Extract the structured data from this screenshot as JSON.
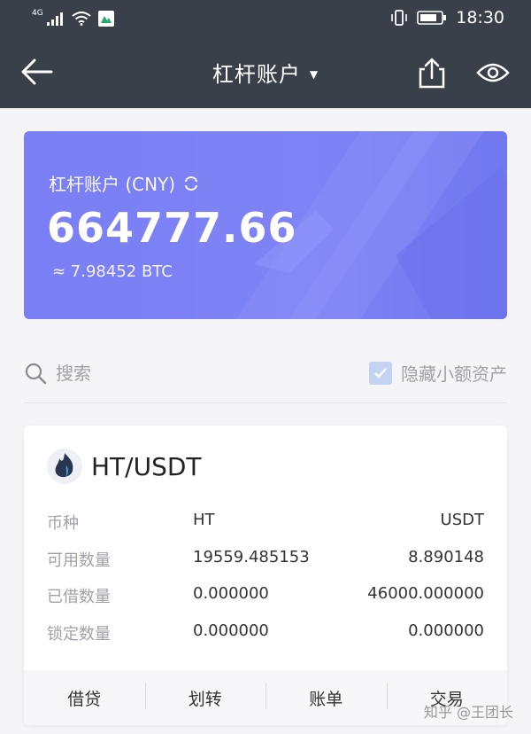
{
  "status_bar": {
    "network": "4G",
    "time": "18:30"
  },
  "nav": {
    "title": "杠杆账户",
    "back_icon": "arrow-left-icon",
    "share_icon": "share-icon",
    "eye_icon": "eye-icon"
  },
  "balance": {
    "label": "杠杆账户 (CNY)",
    "amount": "664777.66",
    "btc": "≈ 7.98452 BTC"
  },
  "search": {
    "placeholder": "搜索",
    "hide_small_label": "隐藏小额资产",
    "hide_small_checked": true
  },
  "asset": {
    "pair": "HT/USDT",
    "rows": [
      {
        "label": "币种",
        "left": "HT",
        "right": "USDT"
      },
      {
        "label": "可用数量",
        "left": "19559.485153",
        "right": "8.890148"
      },
      {
        "label": "已借数量",
        "left": "0.000000",
        "right": "46000.000000"
      },
      {
        "label": "锁定数量",
        "left": "0.000000",
        "right": "0.000000"
      }
    ],
    "actions": [
      "借贷",
      "划转",
      "账单",
      "交易"
    ]
  },
  "watermark": "知乎 @王团长",
  "colors": {
    "header": "#3a4049",
    "card_accent": "#7b7ff5",
    "checkbox": "#c3d3f1"
  }
}
